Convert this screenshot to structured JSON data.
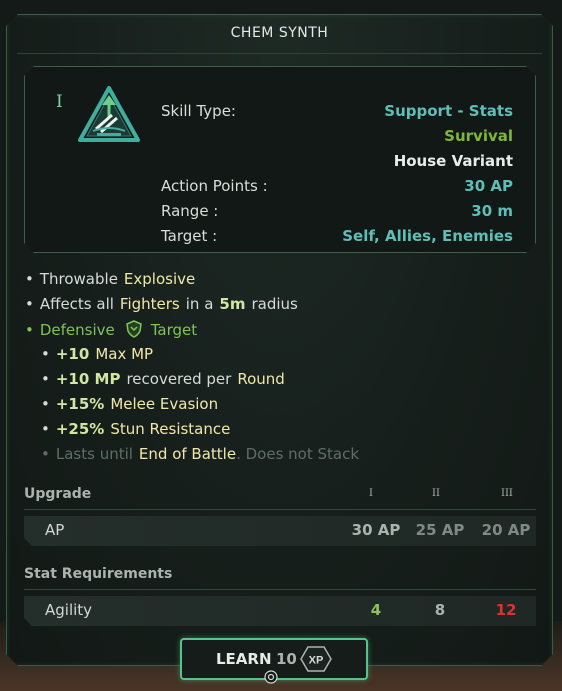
{
  "title": "CHEM SYNTH",
  "tier": "I",
  "info": [
    {
      "key": "Skill Type:",
      "value": "Support - Stats",
      "color": "#5ebfb6"
    },
    {
      "key": "",
      "value": "Survival",
      "color": "#7fb63a"
    },
    {
      "key": "",
      "value": "House Variant",
      "color": "#e8ecea"
    },
    {
      "key": "Action Points :",
      "value": "30 AP",
      "color": "#5ebfb6"
    },
    {
      "key": "Range :",
      "value": "30 m",
      "color": "#5ebfb6"
    },
    {
      "key": "Target :",
      "value": "Self, Allies, Enemies",
      "color": "#5ebfb6"
    }
  ],
  "effects": {
    "line1": {
      "bullet": "•",
      "text": "Throwable",
      "highlight": "Explosive"
    },
    "line2": {
      "bullet": "•",
      "text": "Affects all",
      "highlight1": "Fighters",
      "mid": "in a",
      "num": "5m",
      "tail": "radius"
    },
    "line3": {
      "bullet": "•",
      "text": "Defensive",
      "icon": "shield-icon",
      "tail": "Target"
    },
    "sub": [
      {
        "bullet": "•",
        "num": "+10",
        "text": "Max MP"
      },
      {
        "bullet": "•",
        "num": "+10 MP",
        "text": "recovered per",
        "highlight": "Round"
      },
      {
        "bullet": "•",
        "num": "+15%",
        "text": "Melee Evasion"
      },
      {
        "bullet": "•",
        "num": "+25%",
        "text": "Stun Resistance"
      }
    ],
    "duration": {
      "bullet": "•",
      "text": "Lasts until",
      "highlight": "End of Battle",
      "tail": ". Does not Stack"
    }
  },
  "upgrade": {
    "heading": "Upgrade",
    "tiers": [
      "I",
      "II",
      "III"
    ],
    "row_label": "AP",
    "values": [
      "30 AP",
      "25 AP",
      "20 AP"
    ],
    "colors": [
      "#a9b4af",
      "#7e8a85",
      "#7e8a85"
    ]
  },
  "requirements": {
    "heading": "Stat Requirements",
    "row_label": "Agility",
    "values": [
      "4",
      "8",
      "12"
    ],
    "colors": [
      "#8bc45a",
      "#a9b4af",
      "#e03030"
    ]
  },
  "learn": {
    "label": "LEARN",
    "cost": "10",
    "currency": "XP"
  }
}
